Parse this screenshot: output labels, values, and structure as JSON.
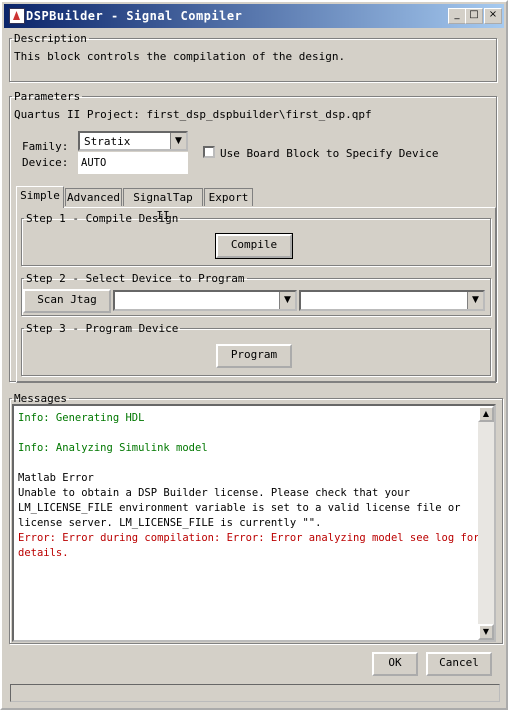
{
  "window": {
    "title": "DSPBuilder - Signal Compiler",
    "minimize": "_",
    "maximize": "□",
    "close": "×"
  },
  "description": {
    "legend": "Description",
    "text": "This block controls the compilation of the design."
  },
  "parameters": {
    "legend": "Parameters",
    "project": "Quartus II Project: first_dsp_dspbuilder\\first_dsp.qpf",
    "family_label": "Family:",
    "family_value": "Stratix",
    "device_label": "Device:",
    "device_value": "AUTO",
    "board_block_label": "Use Board Block to Specify Device",
    "board_block_checked": false
  },
  "tabs": [
    "Simple",
    "Advanced",
    "SignalTap II",
    "Export"
  ],
  "active_tab": "Simple",
  "step1": {
    "legend": "Step 1 - Compile Design",
    "button": "Compile"
  },
  "step2": {
    "legend": "Step 2 - Select Device to Program",
    "button": "Scan Jtag",
    "combo1": "",
    "combo2": ""
  },
  "step3": {
    "legend": "Step 3 - Program Device",
    "button": "Program"
  },
  "messages": {
    "legend": "Messages",
    "lines": [
      {
        "text": "Info: Generating HDL",
        "color": "#007700"
      },
      {
        "text": "",
        "color": "#000000"
      },
      {
        "text": "Info: Analyzing Simulink model",
        "color": "#007700"
      },
      {
        "text": "",
        "color": "#000000"
      },
      {
        "text": "Matlab Error",
        "color": "#000000"
      },
      {
        "text": "Unable to obtain a DSP Builder license. Please check that your",
        "color": "#000000"
      },
      {
        "text": "LM_LICENSE_FILE environment variable is set to a valid license file or",
        "color": "#000000"
      },
      {
        "text": "license server. LM_LICENSE_FILE is currently \"\".",
        "color": "#000000"
      },
      {
        "text": "Error: Error during compilation: Error: Error analyzing model see log for",
        "color": "#bb0000"
      },
      {
        "text": "details.",
        "color": "#bb0000"
      }
    ]
  },
  "footer": {
    "ok": "OK",
    "cancel": "Cancel"
  }
}
